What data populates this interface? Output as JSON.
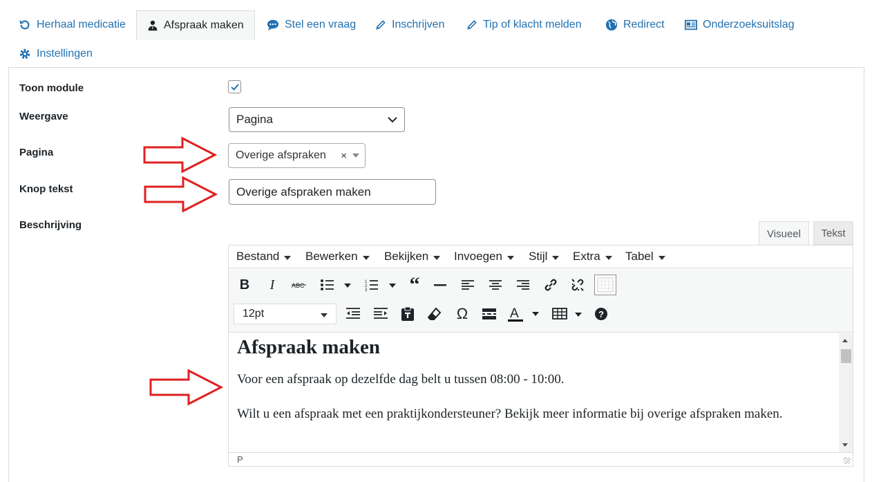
{
  "tabs": [
    {
      "label": "Herhaal medicatie",
      "icon": "refresh-icon",
      "active": false
    },
    {
      "label": "Afspraak maken",
      "icon": "user-icon",
      "active": true
    },
    {
      "label": "Stel een vraag",
      "icon": "chat-icon",
      "active": false
    },
    {
      "label": "Inschrijven",
      "icon": "pencil-icon",
      "active": false
    },
    {
      "label": "Tip of klacht melden",
      "icon": "pencil-icon",
      "active": false
    },
    {
      "label": "Redirect",
      "icon": "globe-icon",
      "active": false
    },
    {
      "label": "Onderzoeksuitslag",
      "icon": "card-icon",
      "active": false
    },
    {
      "label": "Instellingen",
      "icon": "gear-icon",
      "active": false
    }
  ],
  "form": {
    "toon_module": {
      "label": "Toon module",
      "checked": true
    },
    "weergave": {
      "label": "Weergave",
      "value": "Pagina"
    },
    "pagina": {
      "label": "Pagina",
      "value": "Overige afspraken",
      "clear": "×"
    },
    "knop_tekst": {
      "label": "Knop tekst",
      "value": "Overige afspraken maken"
    },
    "beschrijving": {
      "label": "Beschrijving"
    }
  },
  "editor": {
    "tabs": {
      "visual": "Visueel",
      "text": "Tekst"
    },
    "menu": [
      "Bestand",
      "Bewerken",
      "Bekijken",
      "Invoegen",
      "Stijl",
      "Extra",
      "Tabel"
    ],
    "font_size": "12pt",
    "content": {
      "heading": "Afspraak maken",
      "p1": "Voor een afspraak op dezelfde dag belt u tussen 08:00 - 10:00.",
      "p2": "Wilt u een afspraak met een praktijkondersteuner? Bekijk meer informatie bij overige afspraken maken."
    },
    "status_path": "P"
  },
  "colors": {
    "link": "#2271b1",
    "annotation_arrow": "#e02020",
    "checkbox_accent": "#2271b1"
  }
}
